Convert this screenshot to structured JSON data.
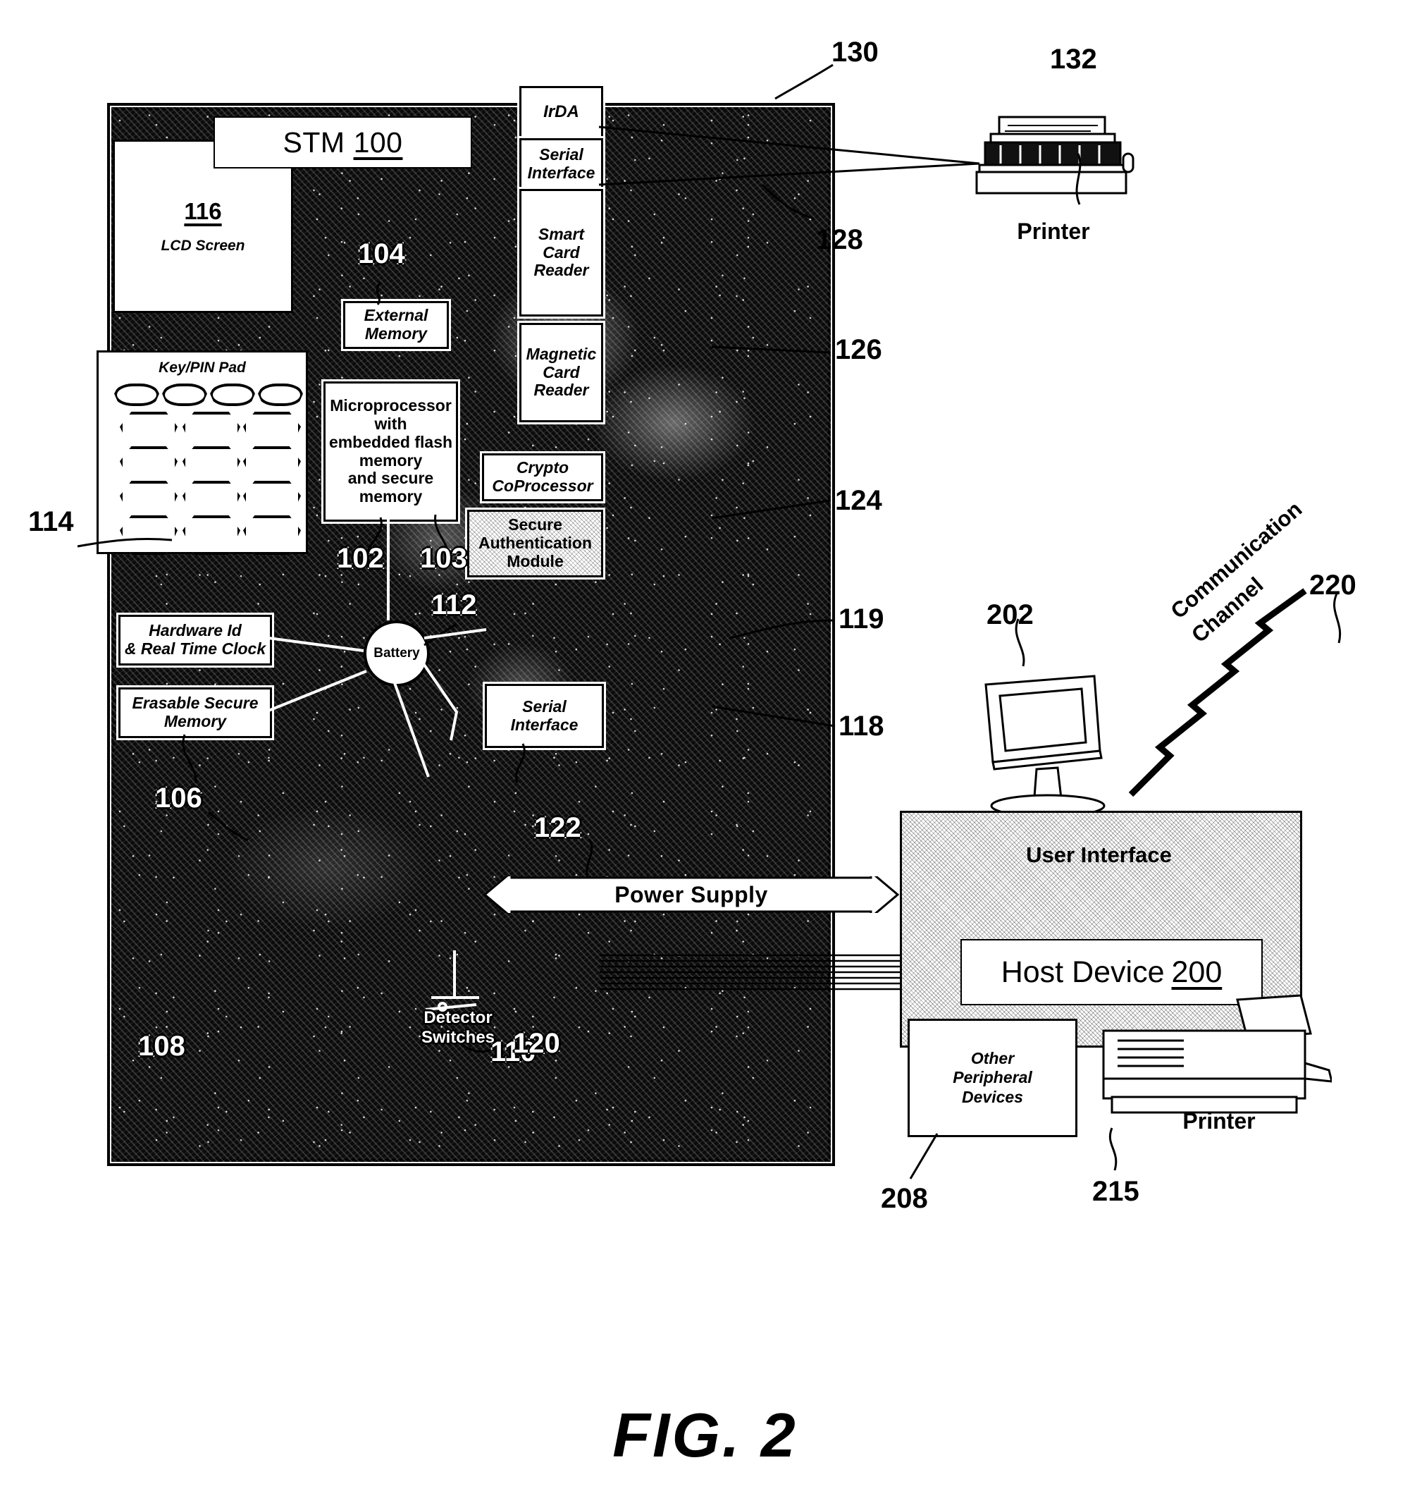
{
  "figure": {
    "caption": "FIG. 2",
    "title_label": "STM",
    "title_ref": "100"
  },
  "stm": {
    "lcd": {
      "ref": "116",
      "label": "LCD Screen"
    },
    "keypad": {
      "label": "Key/PIN Pad",
      "ref": "114"
    },
    "external_memory": {
      "label": "External\nMemory",
      "ref": "104"
    },
    "microprocessor": {
      "line1": "Microprocessor",
      "line2": "with",
      "line3": "embedded flash",
      "line4": "memory",
      "line5": "and secure",
      "line6": "memory",
      "ref_a": "102",
      "ref_b": "103"
    },
    "battery": {
      "label": "Battery",
      "ref": "112"
    },
    "hardware_id": {
      "line1": "Hardware Id",
      "line2": "& Real Time Clock",
      "ref": "106"
    },
    "erasable_memory": {
      "line1": "Erasable Secure",
      "line2": "Memory",
      "ref": "108"
    },
    "detector_switches": {
      "line1": "Detector",
      "line2": "Switches",
      "ref": "110"
    },
    "irda": {
      "label": "IrDA",
      "ref": "130"
    },
    "serial_interface_top": {
      "line1": "Serial",
      "line2": "Interface",
      "ref": "128"
    },
    "smart_card_reader": {
      "line1": "Smart",
      "line2": "Card",
      "line3": "Reader",
      "ref": "126"
    },
    "magnetic_card_reader": {
      "line1": "Magnetic",
      "line2": "Card",
      "line3": "Reader",
      "ref": "124"
    },
    "crypto_coprocessor": {
      "line1": "Crypto",
      "line2": "CoProcessor",
      "ref": "119"
    },
    "secure_auth_module": {
      "line1": "Secure",
      "line2": "Authentication",
      "line3": "Module",
      "ref": "118"
    },
    "serial_interface_bottom": {
      "line1": "Serial",
      "line2": "Interface",
      "ref": "120"
    },
    "power_supply": {
      "label": "Power Supply",
      "ref": "122"
    }
  },
  "external": {
    "printer_top": {
      "label": "Printer",
      "ref": "132"
    },
    "monitor": {
      "ref": "202"
    },
    "user_interface": {
      "label": "User Interface"
    },
    "host_device": {
      "label": "Host Device",
      "ref": "200"
    },
    "other_peripherals": {
      "line1": "Other",
      "line2": "Peripheral",
      "line3": "Devices",
      "ref": "208"
    },
    "printer_bottom": {
      "label": "Printer",
      "ref": "215"
    },
    "communication_channel": {
      "line1": "Communication",
      "line2": "Channel",
      "ref": "220"
    }
  },
  "colors": {
    "ink": "#000000",
    "paper": "#ffffff",
    "panel": "#0b0b0b"
  }
}
